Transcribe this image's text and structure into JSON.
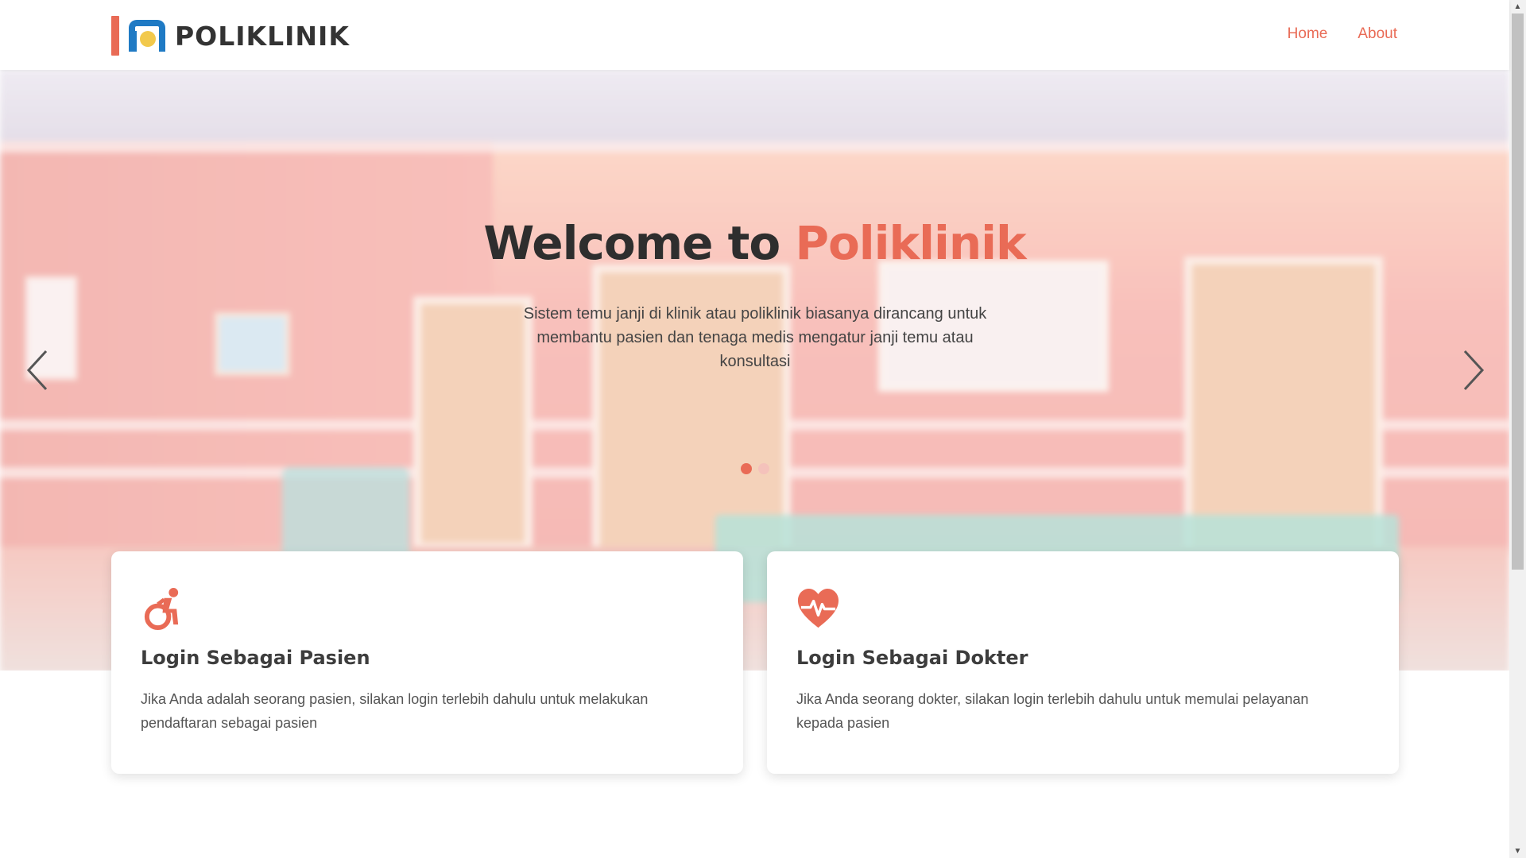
{
  "header": {
    "brand": "POLIKLINIK",
    "nav": [
      {
        "label": "Home"
      },
      {
        "label": "About"
      }
    ]
  },
  "hero": {
    "title_prefix": "Welcome to",
    "title_accent": "Poliklinik",
    "description": "Sistem temu janji di klinik atau poliklinik biasanya dirancang untuk membantu pasien dan tenaga medis mengatur janji temu atau konsultasi",
    "prev_icon": "chevron-left-icon",
    "next_icon": "chevron-right-icon",
    "slides_total": 2,
    "active_slide": 1
  },
  "cards": [
    {
      "icon": "wheelchair-icon",
      "title": "Login Sebagai Pasien",
      "description": "Jika Anda adalah seorang pasien, silakan login terlebih dahulu untuk melakukan pendaftaran sebagai pasien"
    },
    {
      "icon": "heartbeat-icon",
      "title": "Login Sebagai Dokter",
      "description": "Jika Anda seorang dokter, silakan login terlebih dahulu untuk memulai pelayanan kepada pasien"
    }
  ],
  "colors": {
    "accent": "#e96b56",
    "brand_blue": "#1f7ac4",
    "brand_yellow": "#f2c94c",
    "text_dark": "#2e2e2e"
  }
}
